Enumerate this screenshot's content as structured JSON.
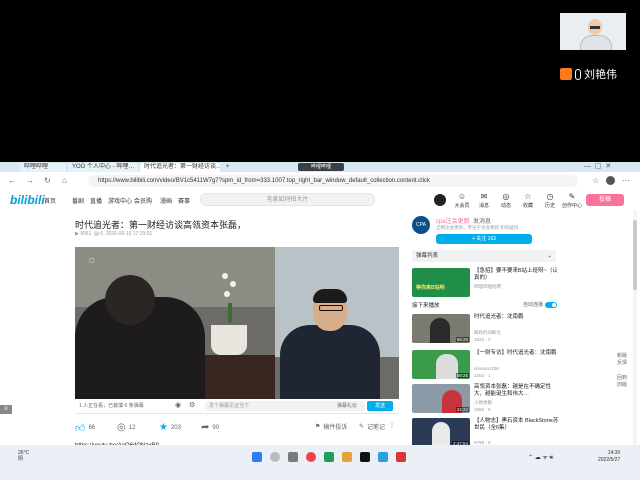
{
  "meeting": {
    "presenter_name": "刘艳伟"
  },
  "browser": {
    "tabs": [
      {
        "label": "哔哩哔哩",
        "active": false
      },
      {
        "label": "YOO 个人中心 - 哔哩…",
        "active": false
      },
      {
        "label": "时代追光者：第一财经访谈…",
        "active": true
      },
      {
        "label": "+",
        "active": false
      }
    ],
    "floating_label": "哔哩哔哩",
    "url": "https://www.bilibili.com/video/BV1c5411W7g7?spm_id_from=333.1007.top_right_bar_window_default_collection.content.click"
  },
  "bilibili": {
    "logo": "bilibili",
    "nav": [
      "首页",
      "番剧",
      "直播",
      "游戏中心",
      "会员购",
      "漫画",
      "赛事"
    ],
    "search_placeholder": "毛家如何拍大片",
    "top_icons": [
      {
        "glyph": "☺",
        "label": "大会员"
      },
      {
        "glyph": "✉",
        "label": "消息"
      },
      {
        "glyph": "◎",
        "label": "动态"
      },
      {
        "glyph": "☆",
        "label": "收藏"
      },
      {
        "glyph": "◷",
        "label": "历史"
      },
      {
        "glyph": "✎",
        "label": "创作中心"
      }
    ],
    "upload_label": "投稿",
    "video": {
      "title": "时代追光者：第一财经访谈高瓴资本张磊，",
      "views": "9061",
      "danmaku_count": "6",
      "date": "2020-06-10 17:29:01"
    },
    "danmu_bar": {
      "watching": "1 人正在看，已装填 6 条弹幕",
      "placeholder": "发个弹幕见证当下",
      "etiquette": "弹幕礼仪",
      "send": "发送"
    },
    "actions": {
      "like": "66",
      "coin": "12",
      "fav": "203",
      "share": "90",
      "report": "稿件投诉",
      "notes": "记笔记"
    },
    "description_link": "https://youtu.be/AoQ6dQNzxR0",
    "uploader": {
      "avatar_text": "CPA",
      "name": "cpa注会更新",
      "tag": "发消息",
      "desc": "全网注会更新，专注于注会更新 如有疑问…",
      "follow": "+ 关注 163"
    },
    "danmaku_list_label": "弹幕列表",
    "recommendations": [
      {
        "title": "【急招】要不要来B站上班呀~（认真的）",
        "uploader": "哔哩哔哩招聘",
        "stats": "",
        "duration": "",
        "thumb_bg": "#1f8f4a",
        "thumb_text": "等你来B站哟"
      },
      {
        "title": "时代追光者：沈南鹏",
        "uploader": "政政的间断论",
        "stats": "1622 · 2",
        "duration": "59:25",
        "thumb_bg": "#7a7a70",
        "thumb_text": ""
      },
      {
        "title": "【一财专访】时代追光者：沈南鹏",
        "uploader": "nirvana1208",
        "stats": "2283 · 1",
        "duration": "59:25",
        "thumb_bg": "#3a9b4a",
        "thumb_text": ""
      },
      {
        "title": "高瓴资本张磊：越是在不确定性大，越能诞生和伟大…",
        "uploader": "小债余粮",
        "stats": "1659 · 5",
        "duration": "24:22",
        "thumb_bg": "#8a9aa6",
        "thumb_text": ""
      },
      {
        "title": "【人物志】黑石资本 BlackStone苏世民（全6集）",
        "uploader": "史蒂芬C",
        "stats": "9798 · 5",
        "duration": "2:47:54",
        "thumb_bg": "#2b3a55",
        "thumb_text": ""
      }
    ],
    "next_up": "接下来播放",
    "autoplay": "自动连播",
    "side_buttons": [
      "新版反馈",
      "回到旧版"
    ]
  },
  "taskbar": {
    "weather_temp": "26°C",
    "weather_desc": "阴",
    "time": "14:30",
    "date": "2022/5/27"
  }
}
